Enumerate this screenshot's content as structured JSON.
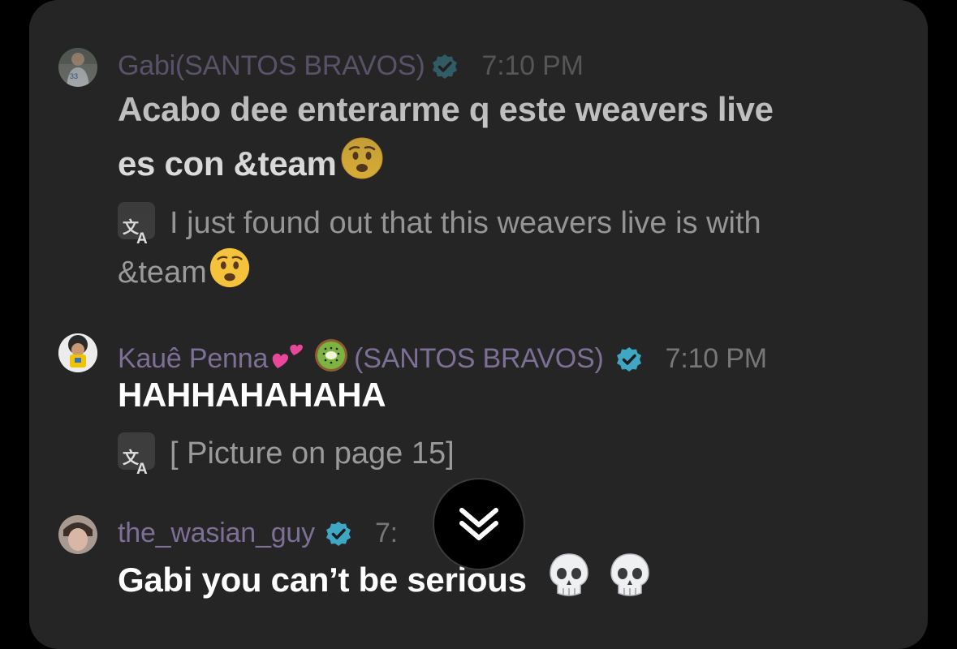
{
  "messages": [
    {
      "author": "Gabi(SANTOS BRAVOS)",
      "verified": true,
      "time": "7:10 PM",
      "text_line1": "Acabo dee enterarme q este weavers live",
      "text_line2": "es con &team",
      "text_emoji": "worried-face",
      "translation_line1": "I just found out that this weavers live is with",
      "translation_line2": "&team",
      "translation_emoji": "worried-face",
      "avatar_jersey": "33"
    },
    {
      "author_part1": "Kauê Penna",
      "author_emoji1": "two-hearts",
      "author_emoji2": "kiwi",
      "author_part2": "(SANTOS BRAVOS)",
      "verified": true,
      "time": "7:10 PM",
      "text": "HAHHAHAHAHA",
      "translation": "[ Picture on page 15]"
    },
    {
      "author": "the_wasian_guy",
      "verified": true,
      "time_partial": "7:",
      "text": "Gabi you can’t be serious",
      "text_emojis": [
        "skull",
        "skull"
      ]
    }
  ],
  "colors": {
    "background": "#000000",
    "panel": "#252525",
    "author_name": "#7d6f96",
    "verified_badge": "#3fa6c4",
    "timestamp": "#777777",
    "message_text": "#ffffff",
    "translation_text": "#9a9a9a"
  },
  "icons": {
    "verified": "verified-badge-icon",
    "translate": "translate-icon",
    "scroll": "chevron-double-down-icon"
  }
}
